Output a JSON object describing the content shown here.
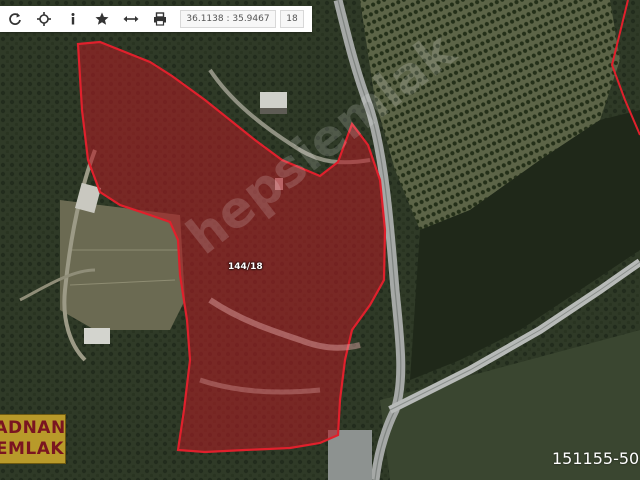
{
  "toolbar": {
    "buttons": [
      {
        "icon": "refresh-icon"
      },
      {
        "icon": "crosshair-icon"
      },
      {
        "icon": "info-icon"
      },
      {
        "icon": "star-icon"
      },
      {
        "icon": "measure-icon"
      },
      {
        "icon": "print-icon"
      }
    ],
    "coordinates": "36.1138 : 35.9467",
    "zoom": "18"
  },
  "parcel": {
    "label": "144/18",
    "fill_color": "#b01c24",
    "border_color": "#e0202c"
  },
  "watermark": "hepsiemlak",
  "logo": {
    "line1": "ADNAN",
    "line2": "EMLAK",
    "background": "#b89a2a",
    "text_color": "#7a1520"
  },
  "listing_number": "151155-50",
  "colors": {
    "terrain": "#2f3a27",
    "road": "#a5a8a6",
    "neighbor_parcel_border": "#e0202c"
  }
}
